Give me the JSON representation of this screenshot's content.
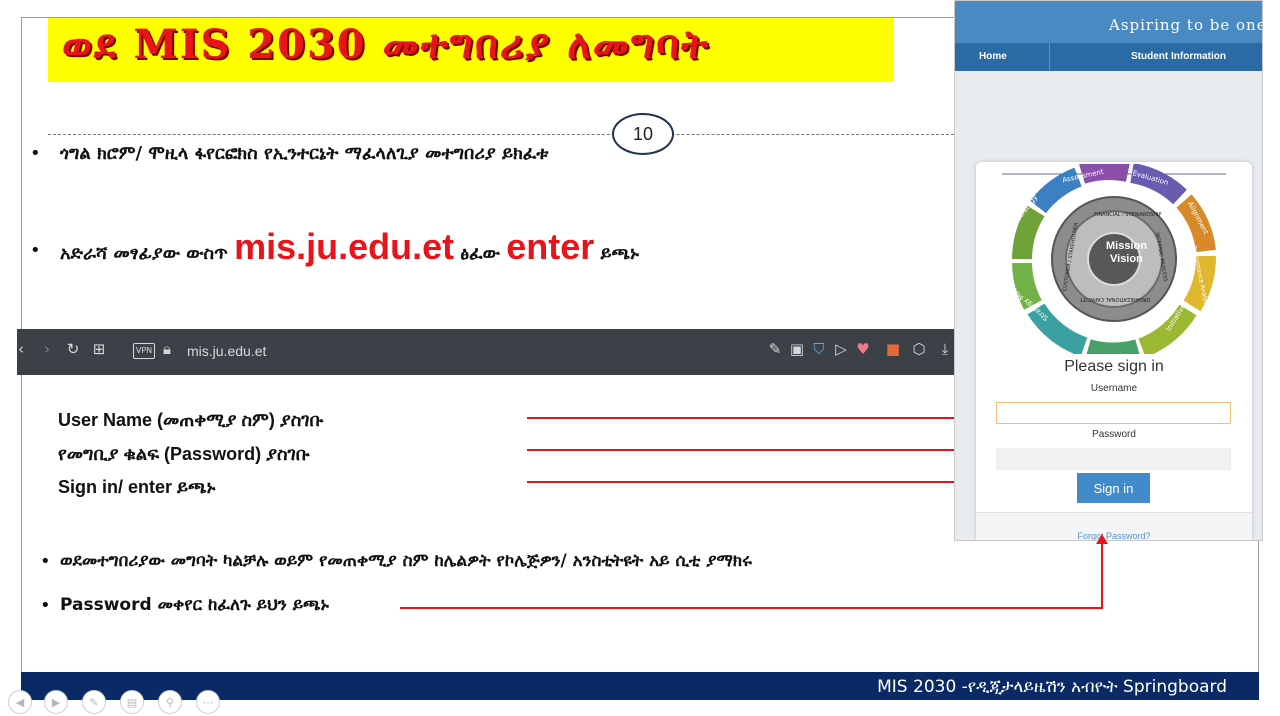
{
  "slide": {
    "title": "ወደ MIS 2030 መተግበሪያ ለመግባት",
    "page_number": "10",
    "bullet1": "ጎግል ክሮም/ ሞዚላ ፋየርፎክስ የኢንተርኔት ማፈላለጊያ መተግበሪያ ይክፈቱ",
    "bullet2": {
      "prefix": "አድራሻ መፃፊያው ውስጥ",
      "url": "mis.ju.edu.et",
      "middle": "ፅፈው",
      "key": "enter",
      "suffix": "ይጫኑ"
    },
    "instructions": [
      "User Name (መጠቀሚያ ስም) ያስገቡ",
      "የመግቢያ ቁልፍ (Password) ያስገቡ",
      "Sign in/ enter ይጫኑ"
    ],
    "bullet3": "ወደመተግበሪያው መግባት ካልቻሉ ወይም የመጠቀሚያ ስም ከሌልዎት የኮሌጅዎን/ አንስቲትዩት አይ ሲቲ ያማክሩ",
    "bullet4": "Password መቀየር ከፈለጉ ይህን ይጫኑ",
    "footer": "MIS 2030 -የዲጂታላይዜሽን አብዮት Springboard"
  },
  "browser": {
    "url": "mis.ju.edu.et",
    "vpn_label": "VPN",
    "left_icons": [
      "back-icon",
      "forward-icon",
      "reload-icon",
      "tabs-grid-icon"
    ],
    "right_icons": [
      "edit-icon",
      "snapshot-icon",
      "shield-icon",
      "play-icon",
      "heart-icon",
      "extension-icon",
      "cube-icon",
      "download-icon",
      "sidebar-icon",
      "menu-icon"
    ]
  },
  "login_page": {
    "banner_text": "Aspiring to be one of",
    "nav": [
      "Home",
      "Student Information"
    ],
    "wheel": {
      "center": [
        "Mission",
        "Vision"
      ],
      "segments": [
        "Assessment",
        "Evaluation",
        "Alignment",
        "Performance Analysis",
        "Initiatives",
        "Performance Measures",
        "Strategy Map",
        "Objectives",
        "Strategy"
      ],
      "inner": [
        "FINANCIAL / STEWARDSHIP",
        "INTERNAL PROCESS",
        "ORGANIZATIONAL CAPACITY",
        "CUSTOMER / STAKEHOLDER"
      ]
    },
    "signin_title": "Please sign in",
    "username_label": "Username",
    "password_label": "Password",
    "username_value": "",
    "password_value": "",
    "signin_button": "Sign in",
    "forgot_link": "Forgot Password?"
  },
  "colors": {
    "title_bg": "#ffff00",
    "title_text": "#e8141c",
    "arrow": "#e8141c",
    "footer_bg": "#0a2a66",
    "nav_bg": "#2a6aa5",
    "button_bg": "#428bca"
  }
}
